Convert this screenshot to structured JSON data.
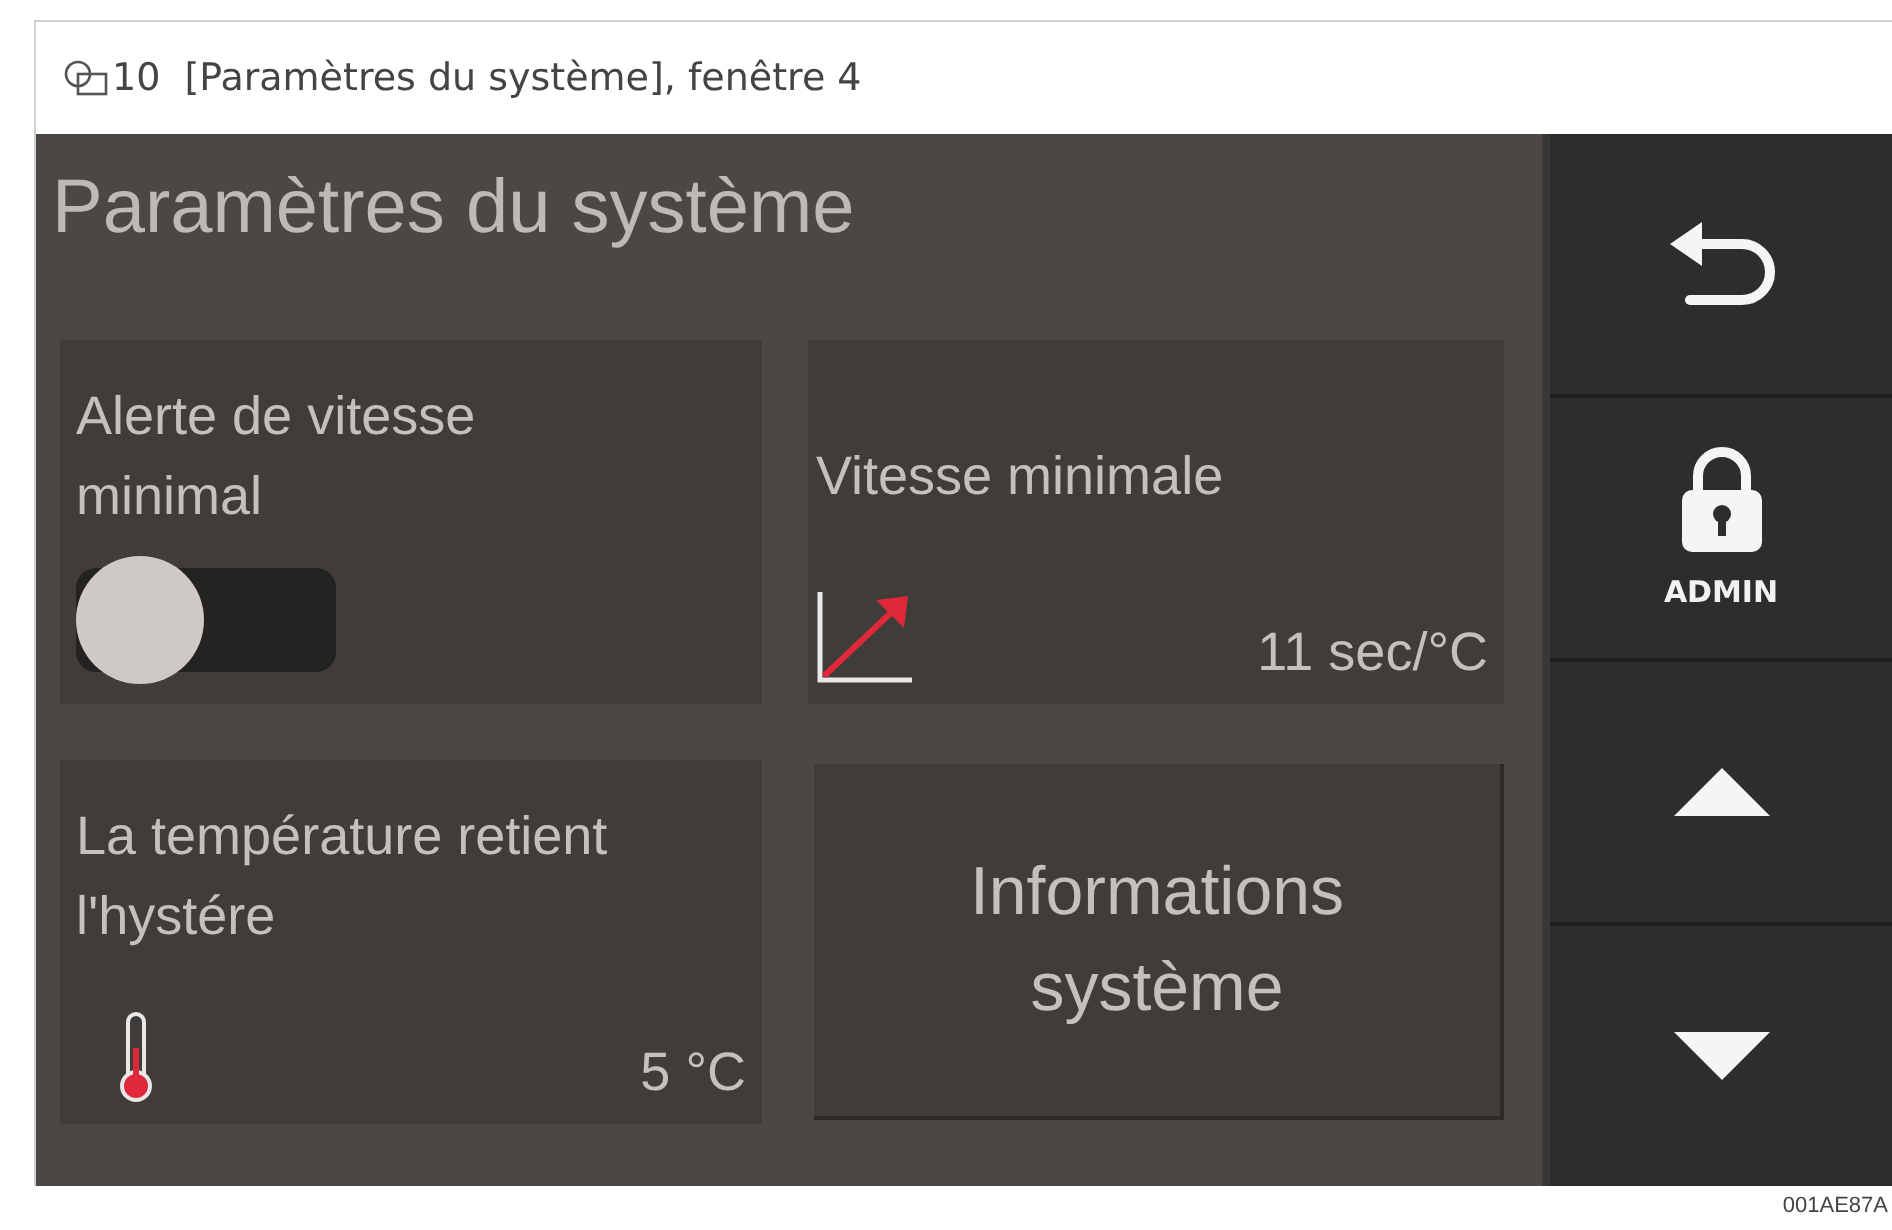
{
  "caption": {
    "number": "10",
    "text": "[Paramètres du système], fenêtre 4"
  },
  "screen": {
    "title": "Paramètres du système",
    "tiles": [
      {
        "kind": "toggle",
        "label": "Alerte de vitesse minimal",
        "on": false
      },
      {
        "kind": "rate",
        "label": "Vitesse minimale",
        "value": "11 sec/°C"
      },
      {
        "kind": "temperature",
        "label": "La température retient l'hystére",
        "value": "5 °C"
      },
      {
        "kind": "button",
        "label": "Informations système"
      }
    ],
    "sidebar": [
      {
        "kind": "back"
      },
      {
        "kind": "lock",
        "label": "ADMIN"
      },
      {
        "kind": "up"
      },
      {
        "kind": "down"
      }
    ]
  },
  "figure_code": "001AE87A"
}
